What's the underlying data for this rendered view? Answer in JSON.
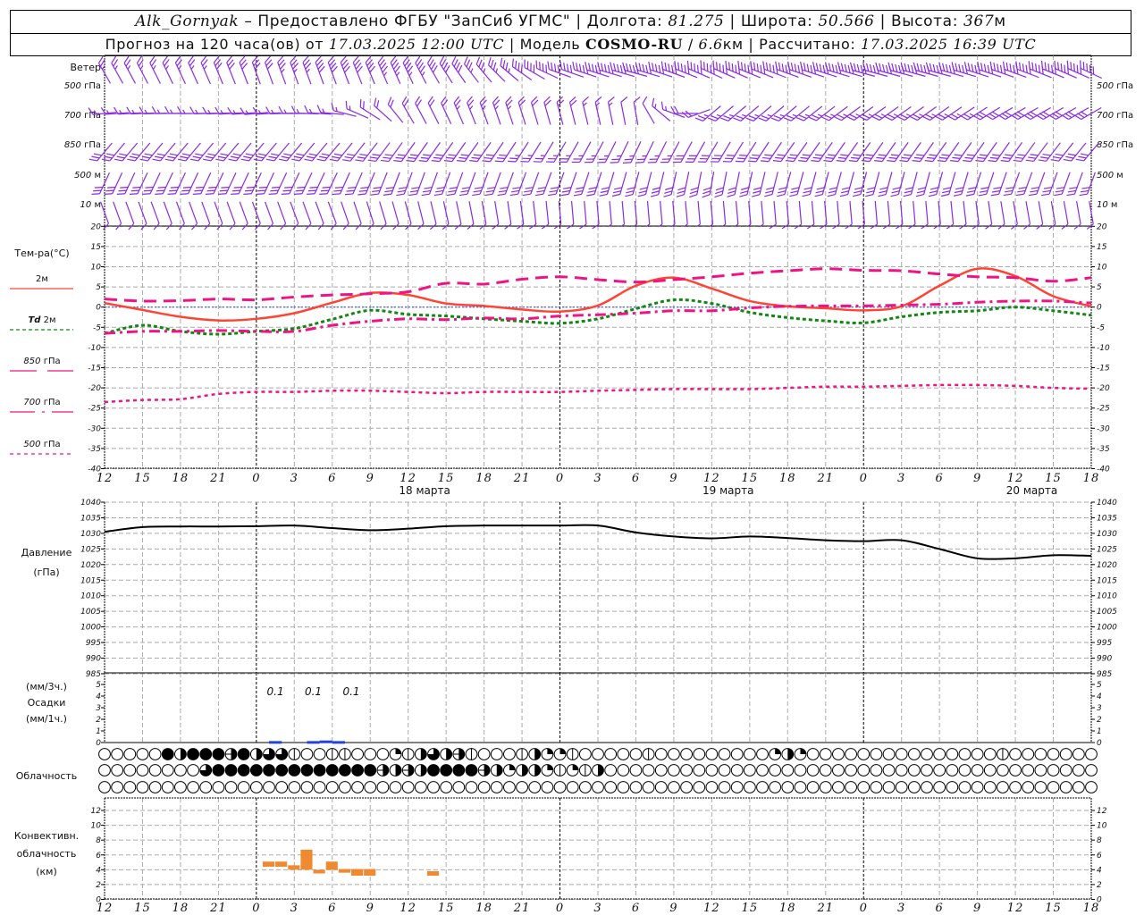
{
  "header": {
    "station": "Alk_Gornyak",
    "dash": " – ",
    "provider": "Предоставлено ФГБУ \"ЗапСиб УГМС\"",
    "sep": " | ",
    "lon_label": "Долгота: ",
    "lon": "81.275",
    "lat_label": "Широта: ",
    "lat": "50.566",
    "alt_label": "Высота: ",
    "alt": "367",
    "alt_unit": "м",
    "forecast_text": "Прогноз на 120 часа(ов) от ",
    "issued": "17.03.2025 12:00 UTC",
    "model_label": "Модель ",
    "model": "COSMO-RU",
    "model_sep": " / ",
    "resolution": "6.6",
    "resolution_unit": "км",
    "computed_label": "Рассчитано: ",
    "computed": "17.03.2025 16:39 UTC"
  },
  "colors": {
    "wind": "#8a2be2",
    "t2m": "#ff4433",
    "td2m": "#118811",
    "upper": "#ee1485",
    "zero_line": "#2244ff",
    "pressure": "#000000",
    "precip": "#2244dd",
    "convective": "#f08a30"
  },
  "time_axis": {
    "labels": [
      "12",
      "15",
      "18",
      "21",
      "0",
      "3",
      "6",
      "9",
      "12",
      "15",
      "18",
      "21",
      "0",
      "3",
      "6",
      "9",
      "12",
      "15",
      "18",
      "21",
      "0",
      "3",
      "6",
      "9",
      "12",
      "15",
      "18"
    ],
    "dates": [
      "18 марта",
      "19 марта",
      "20 марта"
    ]
  },
  "wind": {
    "title": "Ветер",
    "times": [
      "2025-03-17 12:00",
      "2025-03-17 18:00",
      "2025-03-18 00:00",
      "2025-03-18 06:00",
      "2025-03-18 12:00",
      "2025-03-18 18:00",
      "2025-03-19 00:00",
      "2025-03-19 06:00",
      "2025-03-19 12:00",
      "2025-03-19 18:00",
      "2025-03-20 00:00",
      "2025-03-20 06:00",
      "2025-03-20 12:00",
      "2025-03-20 18:00"
    ],
    "levels": [
      {
        "num": "500",
        "unit": "гПа",
        "direction_deg": [
          330,
          335,
          340,
          340,
          335,
          320,
          290,
          285,
          295,
          290,
          285,
          285,
          290,
          295
        ],
        "speed_ms": [
          12,
          13,
          15,
          20,
          22,
          18,
          20,
          25,
          25,
          25,
          25,
          25,
          25,
          25
        ]
      },
      {
        "num": "700",
        "unit": "гПа",
        "direction_deg": [
          265,
          270,
          265,
          275,
          330,
          340,
          345,
          350,
          230,
          230,
          235,
          235,
          240,
          240
        ],
        "speed_ms": [
          8,
          8,
          8,
          8,
          10,
          12,
          10,
          5,
          12,
          12,
          12,
          12,
          15,
          15
        ]
      },
      {
        "num": "850",
        "unit": "гПа",
        "direction_deg": [
          220,
          220,
          220,
          220,
          215,
          215,
          210,
          205,
          210,
          215,
          215,
          215,
          215,
          220
        ],
        "speed_ms": [
          15,
          15,
          15,
          15,
          15,
          15,
          12,
          12,
          15,
          15,
          15,
          15,
          15,
          15
        ]
      },
      {
        "num": "500",
        "unit": "м",
        "direction_deg": [
          205,
          205,
          205,
          205,
          200,
          200,
          200,
          195,
          190,
          195,
          195,
          195,
          200,
          200
        ],
        "speed_ms": [
          15,
          15,
          15,
          15,
          15,
          15,
          15,
          15,
          15,
          15,
          15,
          15,
          15,
          15
        ]
      },
      {
        "num": "10",
        "unit": "м",
        "direction_deg": [
          160,
          160,
          160,
          160,
          165,
          170,
          175,
          175,
          175,
          175,
          175,
          175,
          170,
          170
        ],
        "speed_ms": [
          5,
          5,
          5,
          5,
          5,
          5,
          5,
          3,
          3,
          4,
          5,
          5,
          5,
          5
        ]
      }
    ]
  },
  "chart_data": [
    {
      "type": "line",
      "ylabel": "Тем-ра(°C)",
      "ylim": [
        -40,
        20
      ],
      "yticks": [
        "20",
        "15",
        "10",
        "5",
        "0",
        "-5",
        "-10",
        "-15",
        "-20",
        "-25",
        "-30",
        "-35",
        "-40"
      ],
      "grid": true,
      "legend": "left",
      "x": [
        "2025-03-17 12:00",
        "2025-03-17 15:00",
        "2025-03-17 18:00",
        "2025-03-17 21:00",
        "2025-03-18 00:00",
        "2025-03-18 03:00",
        "2025-03-18 06:00",
        "2025-03-18 09:00",
        "2025-03-18 12:00",
        "2025-03-18 15:00",
        "2025-03-18 18:00",
        "2025-03-18 21:00",
        "2025-03-19 00:00",
        "2025-03-19 03:00",
        "2025-03-19 06:00",
        "2025-03-19 09:00",
        "2025-03-19 12:00",
        "2025-03-19 15:00",
        "2025-03-19 18:00",
        "2025-03-19 21:00",
        "2025-03-20 00:00",
        "2025-03-20 03:00",
        "2025-03-20 06:00",
        "2025-03-20 09:00",
        "2025-03-20 12:00",
        "2025-03-20 15:00",
        "2025-03-20 18:00"
      ],
      "series": [
        {
          "name": "2м",
          "legend_num": "",
          "legend_unit": "2м",
          "values": [
            1,
            -0.7,
            -2.4,
            -3.3,
            -2.9,
            -1.5,
            1.1,
            3.5,
            3,
            0.9,
            0.3,
            -0.6,
            -1.1,
            0.4,
            5.3,
            7.3,
            4.6,
            1.5,
            0.2,
            -0.3,
            -0.8,
            0.2,
            5.3,
            9.5,
            7.7,
            2.7,
            0.2
          ]
        },
        {
          "name": "Td 2м",
          "legend_num": "Td",
          "legend_unit": "2м",
          "values": [
            -6.5,
            -4.5,
            -6,
            -6.7,
            -6,
            -5.3,
            -3,
            -0.8,
            -1.8,
            -2.2,
            -2.9,
            -3.5,
            -4,
            -2.9,
            -0.4,
            1.8,
            0.9,
            -1.3,
            -2.6,
            -3.4,
            -3.9,
            -2.4,
            -1.3,
            -0.9,
            0,
            -0.9,
            -2
          ]
        },
        {
          "name": "850 гПа",
          "legend_num": "850",
          "legend_unit": "гПа",
          "values": [
            2,
            1.5,
            1.6,
            2,
            1.8,
            2.5,
            3,
            3.3,
            3.8,
            5.9,
            5.7,
            6.9,
            7.5,
            6.8,
            6.2,
            6.8,
            7.5,
            8.4,
            9,
            9.5,
            9.1,
            9,
            8.2,
            7.5,
            7.3,
            6.4,
            7.3
          ]
        },
        {
          "name": "700 гПа",
          "legend_num": "700",
          "legend_unit": "гПа",
          "values": [
            -6.5,
            -6,
            -6,
            -5.8,
            -6,
            -6,
            -4.5,
            -3.5,
            -2.9,
            -3.1,
            -2.7,
            -2.9,
            -2.2,
            -1.9,
            -1.5,
            -0.9,
            -0.9,
            -0.2,
            0.2,
            0.3,
            0.3,
            0.5,
            0.7,
            1.2,
            1.5,
            1.5,
            1
          ]
        },
        {
          "name": "500 гПа",
          "legend_num": "500",
          "legend_unit": "гПа",
          "values": [
            -23.5,
            -23,
            -22.8,
            -21.5,
            -21,
            -21,
            -20.7,
            -20.7,
            -21,
            -21.3,
            -21,
            -21,
            -21,
            -20.7,
            -20.5,
            -20.3,
            -20.3,
            -20.3,
            -20,
            -19.7,
            -19.7,
            -19.5,
            -19.3,
            -19.3,
            -19.5,
            -20,
            -20.2
          ]
        }
      ]
    },
    {
      "type": "line",
      "ylabel": "Давление",
      "yunit": "(гПа)",
      "ylim": [
        985,
        1040
      ],
      "yticks": [
        "1040",
        "1035",
        "1030",
        "1025",
        "1020",
        "1015",
        "1010",
        "1005",
        "1000",
        "995",
        "990",
        "985"
      ],
      "grid": true,
      "x_ref": "same as temperature",
      "values": [
        1030.5,
        1032,
        1032.2,
        1032.2,
        1032.3,
        1032.5,
        1031.7,
        1031,
        1031.5,
        1032.3,
        1032.5,
        1032.5,
        1032.5,
        1032.5,
        1030.3,
        1029,
        1028.4,
        1029,
        1028.5,
        1027.8,
        1027.5,
        1027.8,
        1025,
        1022,
        1022,
        1023,
        1022.8
      ]
    },
    {
      "type": "bar",
      "ylabel_top": "(мм/3ч.)",
      "ylabel": "Осадки",
      "ylabel_bottom": "(мм/1ч.)",
      "ylim": [
        0,
        5
      ],
      "yticks": [
        "0",
        "1",
        "2",
        "3",
        "4",
        "5"
      ],
      "hourly": [
        {
          "start": "2025-03-18 01:00",
          "end": "2025-03-18 02:00",
          "value": 0.05
        },
        {
          "start": "2025-03-18 04:00",
          "end": "2025-03-18 05:00",
          "value": 0.05
        },
        {
          "start": "2025-03-18 05:00",
          "end": "2025-03-18 06:00",
          "value": 0.1
        },
        {
          "start": "2025-03-18 06:00",
          "end": "2025-03-18 07:00",
          "value": 0.05
        }
      ],
      "three_hourly_labels": [
        {
          "start": "2025-03-18 00:00",
          "end": "2025-03-18 03:00",
          "value": "0.1"
        },
        {
          "start": "2025-03-18 03:00",
          "end": "2025-03-18 06:00",
          "value": "0.1"
        },
        {
          "start": "2025-03-18 06:00",
          "end": "2025-03-18 09:00",
          "value": "0.1"
        }
      ]
    },
    {
      "type": "table",
      "ylabel": "Облачность",
      "unit": "oktas",
      "start": "2025-03-17 12:00",
      "step_hours": 1,
      "rows": [
        [
          0,
          0,
          0,
          0,
          0,
          8,
          4,
          8,
          8,
          8,
          5,
          8,
          4,
          6,
          6,
          1,
          0,
          0,
          1,
          1,
          0,
          0,
          0,
          2,
          1,
          4,
          6,
          4,
          5,
          1,
          0,
          0,
          0,
          1,
          4,
          2,
          2,
          1,
          0,
          0,
          0,
          0,
          0,
          1,
          0,
          0,
          0,
          0,
          0,
          0,
          0,
          0,
          0,
          2,
          4,
          2,
          0,
          0,
          0,
          0,
          0,
          0,
          0,
          0,
          0,
          0,
          0,
          0,
          0,
          0,
          0,
          1,
          0,
          0,
          0,
          0,
          0,
          0,
          0
        ],
        [
          0,
          0,
          0,
          0,
          0,
          0,
          0,
          0,
          6,
          8,
          8,
          8,
          8,
          8,
          8,
          8,
          8,
          8,
          8,
          8,
          8,
          8,
          5,
          4,
          5,
          4,
          8,
          8,
          8,
          8,
          5,
          4,
          2,
          4,
          4,
          2,
          1,
          2,
          1,
          4,
          0,
          0,
          0,
          0,
          0,
          0,
          0,
          0,
          0,
          0,
          0,
          0,
          0,
          0,
          0,
          0,
          0,
          0,
          0,
          0,
          0,
          0,
          0,
          0,
          0,
          0,
          0,
          0,
          0,
          0,
          0,
          0,
          0,
          0,
          0,
          0,
          0,
          0,
          0
        ],
        [
          0,
          0,
          0,
          0,
          0,
          0,
          0,
          0,
          0,
          0,
          0,
          0,
          0,
          0,
          0,
          0,
          0,
          0,
          0,
          0,
          0,
          0,
          0,
          0,
          0,
          0,
          0,
          0,
          0,
          0,
          0,
          0,
          0,
          0,
          0,
          0,
          0,
          0,
          0,
          0,
          0,
          0,
          0,
          0,
          0,
          0,
          0,
          0,
          0,
          0,
          0,
          0,
          0,
          0,
          0,
          0,
          0,
          0,
          0,
          0,
          0,
          0,
          0,
          0,
          0,
          0,
          0,
          0,
          0,
          0,
          0,
          0,
          0,
          0,
          0,
          0,
          0,
          0,
          0
        ]
      ]
    },
    {
      "type": "bar",
      "ylabel": "Конвективн.",
      "ylabel2": "облачность",
      "yunit": "(км)",
      "ylim": [
        0,
        12
      ],
      "yticks": [
        "0",
        "2",
        "4",
        "6",
        "8",
        "10",
        "12"
      ],
      "bars": [
        {
          "time": "2025-03-18 01:00",
          "base": 4.4,
          "top": 5.1
        },
        {
          "time": "2025-03-18 02:00",
          "base": 4.4,
          "top": 5.1
        },
        {
          "time": "2025-03-18 03:00",
          "base": 4.0,
          "top": 4.6
        },
        {
          "time": "2025-03-18 04:00",
          "base": 4.0,
          "top": 6.7
        },
        {
          "time": "2025-03-18 05:00",
          "base": 3.5,
          "top": 4.0
        },
        {
          "time": "2025-03-18 06:00",
          "base": 4.0,
          "top": 5.1
        },
        {
          "time": "2025-03-18 07:00",
          "base": 3.6,
          "top": 4.1
        },
        {
          "time": "2025-03-18 08:00",
          "base": 3.2,
          "top": 4.1
        },
        {
          "time": "2025-03-18 09:00",
          "base": 3.2,
          "top": 4.1
        },
        {
          "time": "2025-03-18 14:00",
          "base": 3.2,
          "top": 3.8
        }
      ]
    }
  ]
}
